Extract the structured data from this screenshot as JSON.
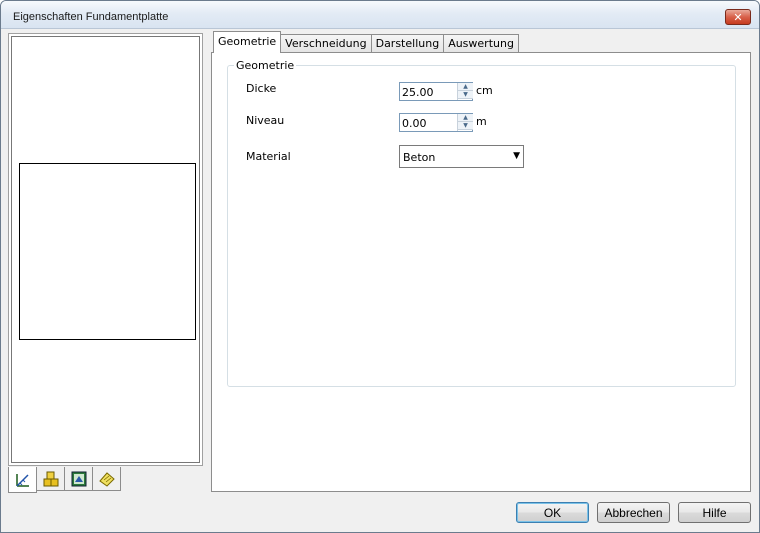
{
  "window": {
    "title": "Eigenschaften Fundamentplatte",
    "close_symbol": "✕"
  },
  "tabs": [
    {
      "label": "Geometrie",
      "active": true
    },
    {
      "label": "Verschneidung",
      "active": false
    },
    {
      "label": "Darstellung",
      "active": false
    },
    {
      "label": "Auswertung",
      "active": false
    }
  ],
  "group": {
    "title": "Geometrie"
  },
  "fields": {
    "dicke": {
      "label": "Dicke",
      "value": "25.00",
      "unit": "cm"
    },
    "niveau": {
      "label": "Niveau",
      "value": "0.00",
      "unit": "m"
    },
    "material": {
      "label": "Material",
      "value": "Beton"
    }
  },
  "bottom_tabs": [
    {
      "icon": "measure-icon",
      "active": true
    },
    {
      "icon": "blocks-icon",
      "active": false
    },
    {
      "icon": "layer-icon",
      "active": false
    },
    {
      "icon": "note-icon",
      "active": false
    }
  ],
  "buttons": {
    "ok": "OK",
    "cancel": "Abbrechen",
    "help": "Hilfe"
  },
  "colors": {
    "close_button": "#c63b1f",
    "default_button_border": "#3c7fb1"
  }
}
